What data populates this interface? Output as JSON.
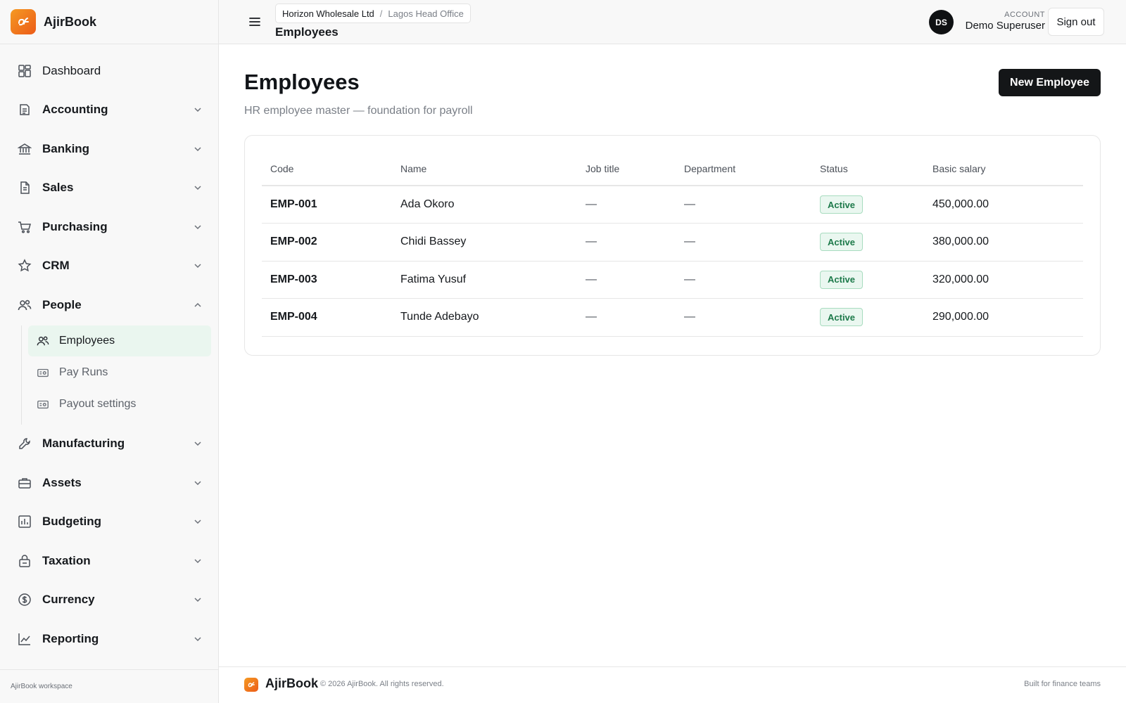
{
  "brand": {
    "name": "AjirBook",
    "accent_start": "#f59a23",
    "accent_end": "#ec5b18"
  },
  "sidebar": {
    "items": [
      {
        "label": "Dashboard",
        "icon": "dashboard-icon",
        "expandable": false
      },
      {
        "label": "Accounting",
        "icon": "ledger-icon",
        "expandable": true
      },
      {
        "label": "Banking",
        "icon": "bank-icon",
        "expandable": true
      },
      {
        "label": "Sales",
        "icon": "document-icon",
        "expandable": true
      },
      {
        "label": "Purchasing",
        "icon": "cart-icon",
        "expandable": true
      },
      {
        "label": "CRM",
        "icon": "star-icon",
        "expandable": true
      },
      {
        "label": "People",
        "icon": "users-icon",
        "expandable": true,
        "expanded": true
      },
      {
        "label": "Manufacturing",
        "icon": "wrench-icon",
        "expandable": true
      },
      {
        "label": "Assets",
        "icon": "briefcase-icon",
        "expandable": true
      },
      {
        "label": "Budgeting",
        "icon": "bar-chart-icon",
        "expandable": true
      },
      {
        "label": "Taxation",
        "icon": "lock-icon",
        "expandable": true
      },
      {
        "label": "Currency",
        "icon": "coin-icon",
        "expandable": true
      },
      {
        "label": "Reporting",
        "icon": "line-chart-icon",
        "expandable": true
      }
    ],
    "people_sub": [
      {
        "label": "Employees",
        "icon": "users-icon",
        "active": true
      },
      {
        "label": "Pay Runs",
        "icon": "money-icon",
        "active": false
      },
      {
        "label": "Payout settings",
        "icon": "money-icon",
        "active": false
      }
    ],
    "footer": "AjirBook workspace"
  },
  "topbar": {
    "breadcrumb": [
      "Horizon Wholesale Ltd",
      "Lagos Head Office"
    ],
    "breadcrumb_sep": "/",
    "title": "Employees",
    "avatar_initials": "DS",
    "account_label": "ACCOUNT",
    "account_name": "Demo Superuser",
    "signout_label": "Sign out"
  },
  "main": {
    "title": "Employees",
    "subtitle": "HR employee master — foundation for payroll",
    "new_button": "New Employee",
    "table": {
      "columns": [
        "Code",
        "Name",
        "Job title",
        "Department",
        "Status",
        "Basic salary"
      ],
      "rows": [
        {
          "code": "EMP-001",
          "name": "Ada Okoro",
          "job_title": "—",
          "department": "—",
          "status": "Active",
          "salary": "450,000.00"
        },
        {
          "code": "EMP-002",
          "name": "Chidi Bassey",
          "job_title": "—",
          "department": "—",
          "status": "Active",
          "salary": "380,000.00"
        },
        {
          "code": "EMP-003",
          "name": "Fatima Yusuf",
          "job_title": "—",
          "department": "—",
          "status": "Active",
          "salary": "320,000.00"
        },
        {
          "code": "EMP-004",
          "name": "Tunde Adebayo",
          "job_title": "—",
          "department": "—",
          "status": "Active",
          "salary": "290,000.00"
        }
      ]
    }
  },
  "footer": {
    "brand": "AjirBook",
    "copyright": "© 2026 AjirBook. All rights reserved.",
    "tagline": "Built for finance teams"
  },
  "colors": {
    "status_active_bg": "#eaf7f0",
    "status_active_text": "#1d7a4a",
    "primary_button": "#141618"
  }
}
